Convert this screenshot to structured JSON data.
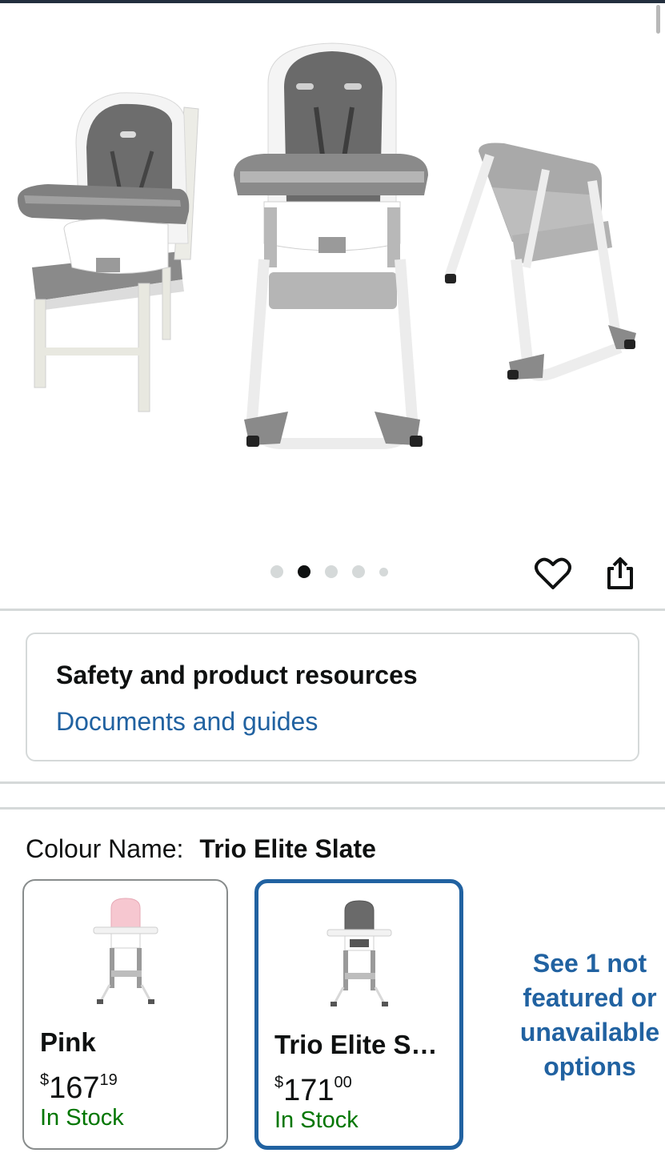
{
  "carousel": {
    "dots_total": 5,
    "active_index": 1
  },
  "icons": {
    "wishlist": "heart-icon",
    "share": "share-icon"
  },
  "resources": {
    "title": "Safety and product resources",
    "link": "Documents and guides"
  },
  "colour": {
    "label": "Colour Name:",
    "selected": "Trio Elite Slate",
    "options": [
      {
        "name": "Pink",
        "price_whole": "167",
        "price_fraction": "19",
        "currency": "$",
        "stock": "In Stock",
        "selected": false
      },
      {
        "name": "Trio Elite S…",
        "price_whole": "171",
        "price_fraction": "00",
        "currency": "$",
        "stock": "In Stock",
        "selected": true
      }
    ],
    "see_more": "See 1 not featured or unavailable options"
  },
  "colors": {
    "link": "#2162a1",
    "in_stock": "#007600",
    "selected_border": "#2162a1"
  }
}
